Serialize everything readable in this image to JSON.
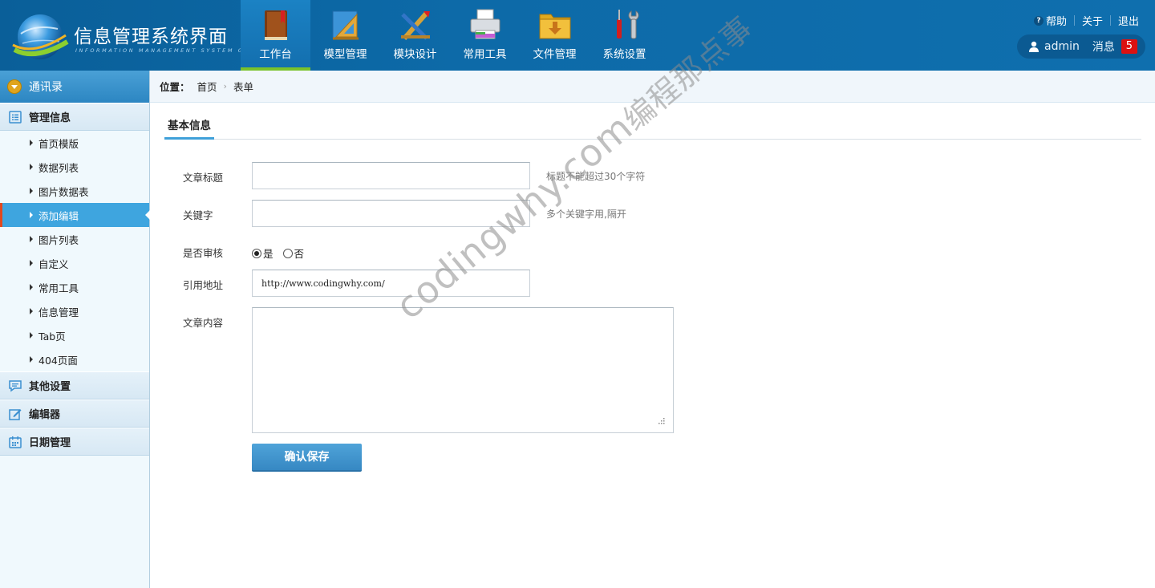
{
  "header": {
    "title": "信息管理系统界面",
    "subtitle": "INFORMATION MANAGEMENT SYSTEM GUI",
    "nav": [
      {
        "label": "工作台",
        "icon": "workbench-book-icon",
        "active": true
      },
      {
        "label": "模型管理",
        "icon": "ruler-triangle-icon",
        "active": false
      },
      {
        "label": "模块设计",
        "icon": "pencil-ruler-icon",
        "active": false
      },
      {
        "label": "常用工具",
        "icon": "printer-icon",
        "active": false
      },
      {
        "label": "文件管理",
        "icon": "folder-download-icon",
        "active": false
      },
      {
        "label": "系统设置",
        "icon": "tools-wrench-icon",
        "active": false
      }
    ],
    "links": {
      "help": "帮助",
      "about": "关于",
      "logout": "退出"
    },
    "user": {
      "name": "admin",
      "messages_label": "消息",
      "messages_count": "5"
    }
  },
  "sidebar": {
    "header": "通讯录",
    "groups": [
      {
        "label": "管理信息",
        "icon": "list-icon"
      },
      {
        "label": "其他设置",
        "icon": "chat-icon"
      },
      {
        "label": "编辑器",
        "icon": "edit-icon"
      },
      {
        "label": "日期管理",
        "icon": "calendar-icon"
      }
    ],
    "items": [
      "首页模版",
      "数据列表",
      "图片数据表",
      "添加编辑",
      "图片列表",
      "自定义",
      "常用工具",
      "信息管理",
      "Tab页",
      "404页面"
    ],
    "active_item": "添加编辑"
  },
  "breadcrumb": {
    "label": "位置：",
    "items": [
      "首页",
      "表单"
    ]
  },
  "section_tab": "基本信息",
  "form": {
    "title_label": "文章标题",
    "title_value": "",
    "title_hint": "标题不能超过30个字符",
    "keywords_label": "关键字",
    "keywords_value": "",
    "keywords_hint": "多个关键字用,隔开",
    "audit_label": "是否审核",
    "audit_options": [
      "是",
      "否"
    ],
    "audit_selected": "是",
    "url_label": "引用地址",
    "url_value": "http://www.codingwhy.com/",
    "content_label": "文章内容",
    "content_value": "",
    "save_label": "确认保存"
  },
  "watermark": {
    "text": "codingwhy.com",
    "text_cn": "编程那点事"
  },
  "colors": {
    "header_bg": "#0d6aa8",
    "nav_active_bar": "#79c22c",
    "sidebar_active": "#3ea5df",
    "button": "#3f95cf",
    "badge": "#dd1111"
  }
}
